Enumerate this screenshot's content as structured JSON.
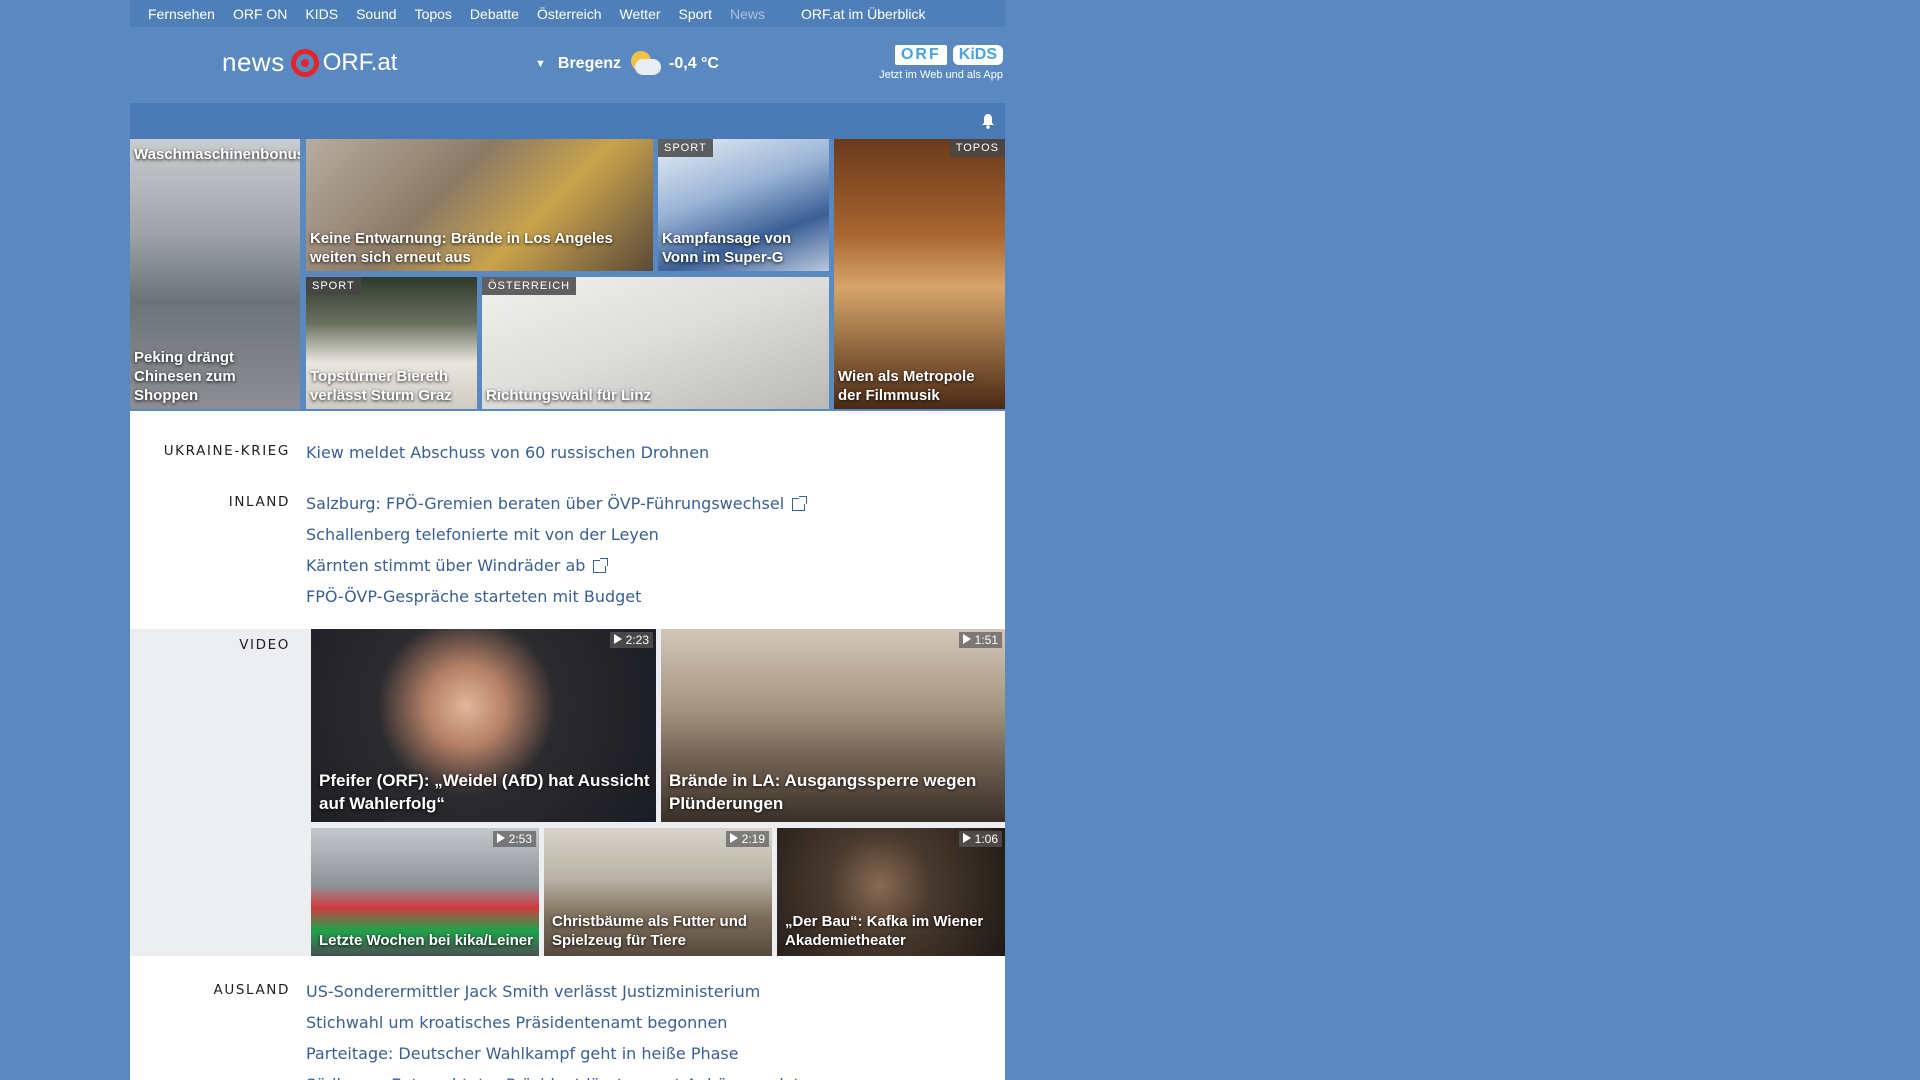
{
  "topnav": {
    "items": [
      "Fernsehen",
      "ORF ON",
      "KIDS",
      "Sound",
      "Topos",
      "Debatte",
      "Österreich",
      "Wetter",
      "Sport",
      "News"
    ],
    "overview": "ORF.at im Überblick"
  },
  "header": {
    "logo_news": "news",
    "logo_orfat": "ORF.at",
    "weather_city": "Bregenz",
    "weather_temp": "-0,4 °C",
    "kids_orf": "ORF",
    "kids_kids": "KiDS",
    "kids_sub": "Jetzt im Web und als App"
  },
  "teasers": [
    {
      "label": "",
      "caption": "Waschmaschinenbonus:"
    },
    {
      "label": "",
      "caption": "Keine Entwarnung: Brände in Los Angeles weiten sich erneut aus"
    },
    {
      "label": "SPORT",
      "caption": "Kampfansage von Vonn im Super-G"
    },
    {
      "label": "TOPOS",
      "caption": "Wien als Metropole der Filmmusik"
    },
    {
      "label": "",
      "caption": "Peking drängt Chinesen zum Shoppen"
    },
    {
      "label": "SPORT",
      "caption": "Topstürmer Biereth verlässt Sturm Graz"
    },
    {
      "label": "ÖSTERREICH",
      "caption": "Richtungswahl für Linz"
    }
  ],
  "sections": {
    "ukraine": {
      "title": "UKRAINE-KRIEG",
      "links": [
        "Kiew meldet Abschuss von 60 russischen Drohnen"
      ]
    },
    "inland": {
      "title": "INLAND",
      "links": [
        "Salzburg: FPÖ-Gremien beraten über ÖVP-Führungswechsel",
        "Schallenberg telefonierte mit von der Leyen",
        "Kärnten stimmt über Windräder ab",
        "FPÖ-ÖVP-Gespräche starteten mit Budget"
      ]
    },
    "video": {
      "title": "VIDEO",
      "items": [
        {
          "duration": "2:23",
          "caption": "Pfeifer (ORF): „Weidel (AfD) hat Aussicht auf Wahlerfolg“"
        },
        {
          "duration": "1:51",
          "caption": "Brände in LA: Ausgangssperre wegen Plünderungen"
        },
        {
          "duration": "2:53",
          "caption": "Letzte Wochen bei kika/Leiner"
        },
        {
          "duration": "2:19",
          "caption": "Christbäume als Futter und Spielzeug für Tiere"
        },
        {
          "duration": "1:06",
          "caption": "„Der Bau“: Kafka im Wiener Akademietheater"
        }
      ]
    },
    "ausland": {
      "title": "AUSLAND",
      "links": [
        "US-Sonderermittler Jack Smith verlässt Justizministerium",
        "Stichwahl um kroatisches Präsidentenamt begonnen",
        "Parteitage: Deutscher Wahlkampf geht in heiße Phase",
        "Südkorea: Entmachteter Präsident lässt erneut Anhörung platzen"
      ]
    }
  },
  "colors": {
    "background": "#5a89c2",
    "link": "#3a5f92",
    "orf_red": "#e3242b"
  }
}
